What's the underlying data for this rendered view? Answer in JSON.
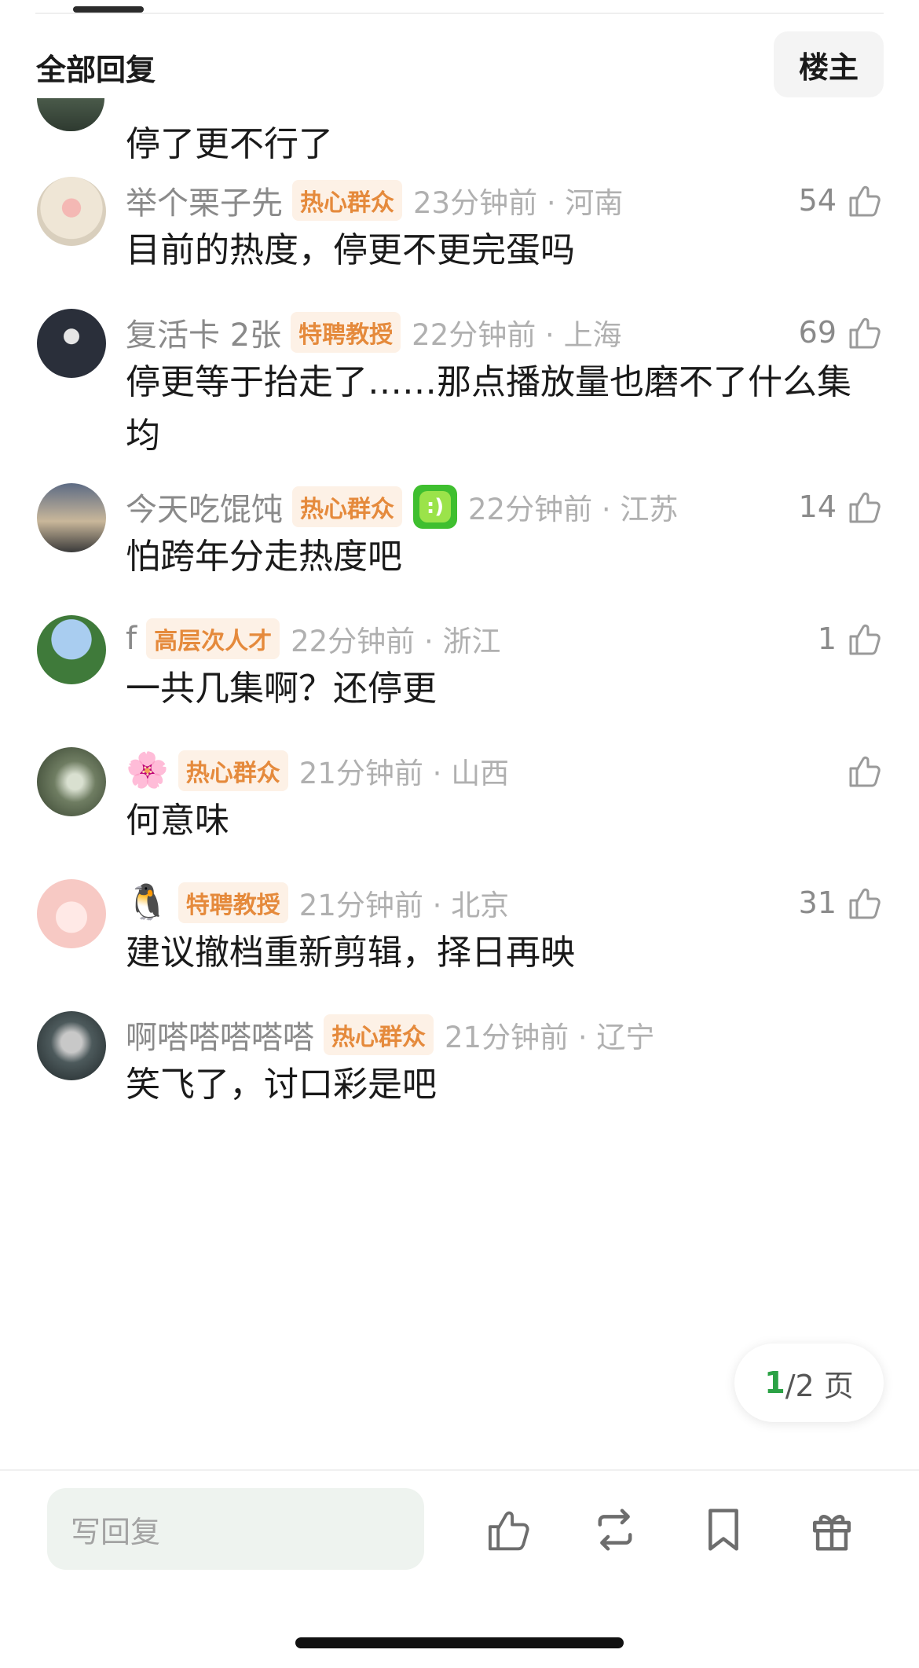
{
  "header": {
    "title": "全部回复",
    "op_button": "楼主"
  },
  "partial_comment": {
    "content": "停了更不行了"
  },
  "comments": [
    {
      "username": "举个栗子先",
      "badge": "热心群众",
      "time": "23分钟前",
      "location": "河南",
      "likes": "54",
      "content": "目前的热度，停更不更完蛋吗"
    },
    {
      "username": "复活卡 2张",
      "badge": "特聘教授",
      "time": "22分钟前",
      "location": "上海",
      "likes": "69",
      "content": "停更等于抬走了……那点播放量也磨不了什么集均"
    },
    {
      "username": "今天吃馄饨",
      "badge": "热心群众",
      "time": "22分钟前",
      "location": "江苏",
      "likes": "14",
      "content": "怕跨年分走热度吧"
    },
    {
      "username": "f",
      "badge": "高层次人才",
      "time": "22分钟前",
      "location": "浙江",
      "likes": "1",
      "content": "一共几集啊？还停更"
    },
    {
      "username": "🌸",
      "badge": "热心群众",
      "time": "21分钟前",
      "location": "山西",
      "likes": "",
      "content": "何意味"
    },
    {
      "username": "🐧",
      "badge": "特聘教授",
      "time": "21分钟前",
      "location": "北京",
      "likes": "31",
      "content": "建议撤档重新剪辑，择日再映"
    },
    {
      "username": "啊嗒嗒嗒嗒嗒",
      "badge": "热心群众",
      "time": "21分钟前",
      "location": "辽宁",
      "likes": "",
      "content": "笑飞了，讨口彩是吧"
    }
  ],
  "pagination": {
    "current": "1",
    "total": "/2 页"
  },
  "bottom_bar": {
    "reply_placeholder": "写回复"
  },
  "colors": {
    "badge_text": "#e58a3c",
    "badge_bg": "#fdf1e6",
    "page_current": "#2ba245",
    "reply_bg": "#eef3ef"
  }
}
